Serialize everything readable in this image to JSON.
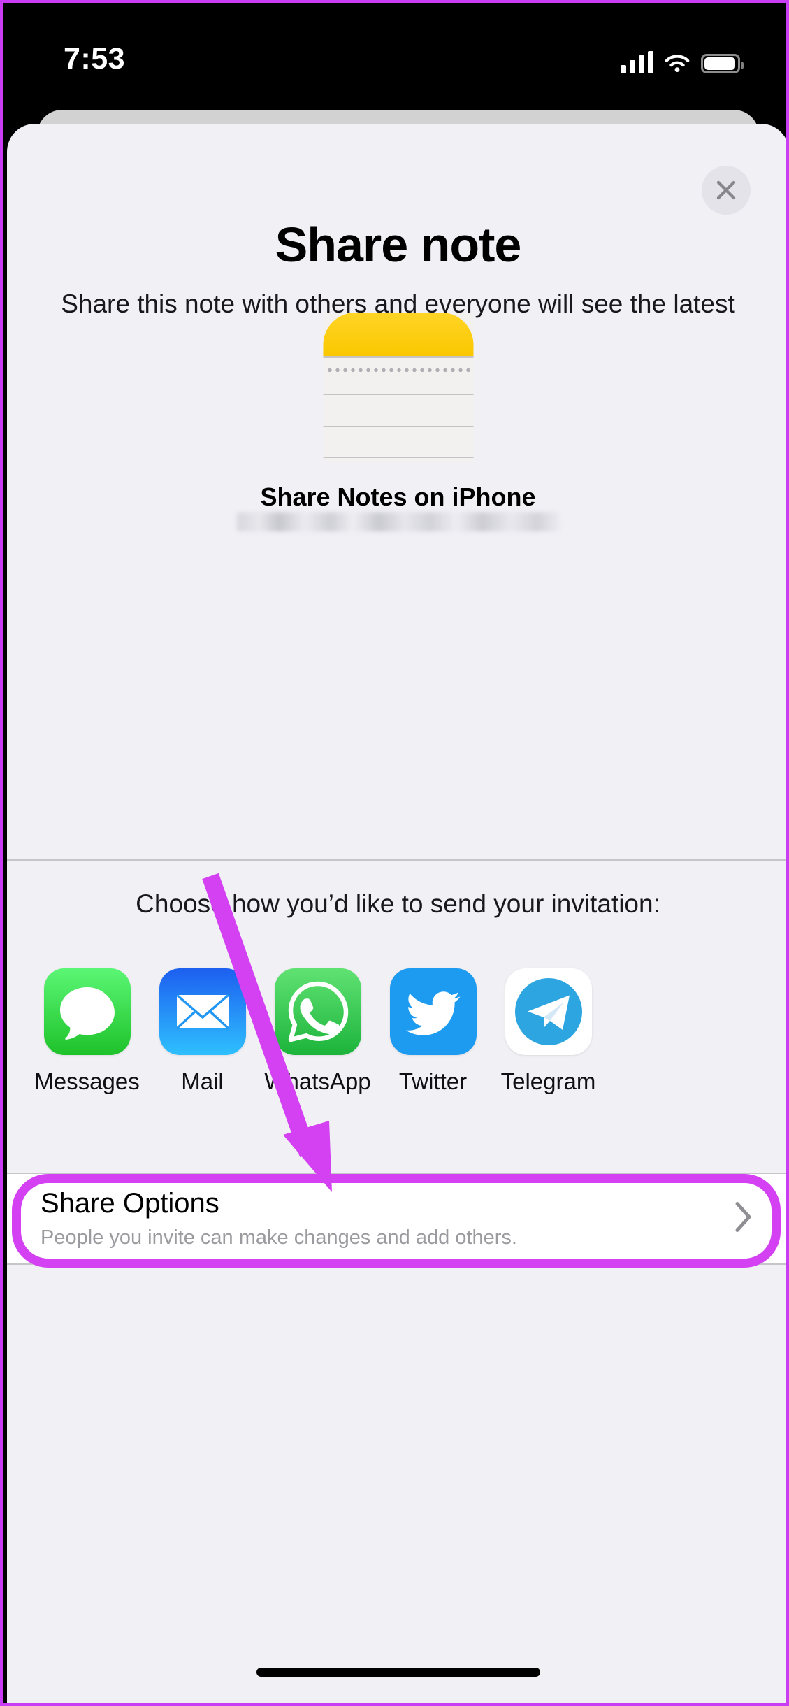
{
  "status_bar": {
    "time": "7:53",
    "cellular_icon": "cellular-bars-icon",
    "wifi_icon": "wifi-icon",
    "battery_icon": "battery-icon"
  },
  "sheet": {
    "close_icon": "close-icon",
    "title": "Share note",
    "subtitle": "Share this note with others and everyone will see the latest changes.",
    "note_preview": {
      "icon": "notes-app-icon",
      "name": "Share Notes on iPhone",
      "detail_redacted": ""
    },
    "choose_label": "Choose how you’d like to send your invitation:",
    "apps": [
      {
        "label": "Messages",
        "icon": "messages-icon",
        "color": "#1ec22a"
      },
      {
        "label": "Mail",
        "icon": "mail-icon",
        "color": "#2ec0fe"
      },
      {
        "label": "WhatsApp",
        "icon": "whatsapp-icon",
        "color": "#1cb43b"
      },
      {
        "label": "Twitter",
        "icon": "twitter-icon",
        "color": "#1d9bf0"
      },
      {
        "label": "Telegram",
        "icon": "telegram-icon",
        "color": "#2ca5e0"
      }
    ],
    "share_options": {
      "title": "Share Options",
      "subtitle": "People you invite can make changes and add others.",
      "chevron_icon": "chevron-right-icon"
    }
  },
  "annotation": {
    "color": "#d341f2",
    "arrow_icon": "arrow-pointer",
    "highlight_target": "share-options-row"
  }
}
